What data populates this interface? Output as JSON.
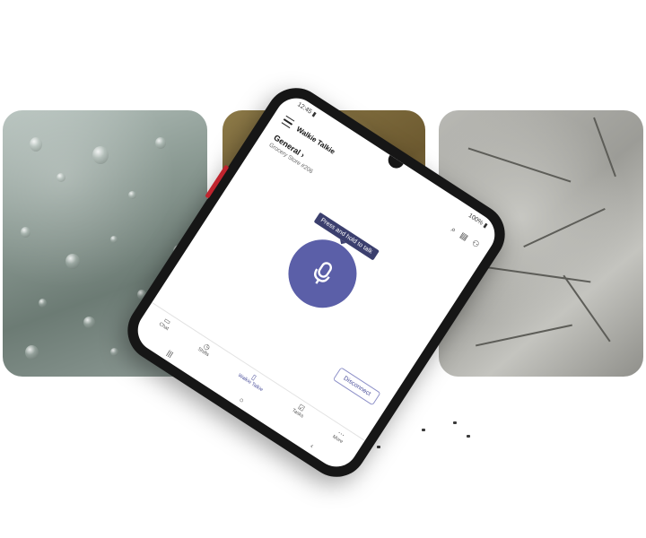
{
  "status_bar": {
    "time": "12:45",
    "signal": "▮",
    "battery": "100%"
  },
  "app": {
    "title": "Walkie Talkie"
  },
  "channel": {
    "name": "General",
    "chevron": "›",
    "team": "Grocery Store #206"
  },
  "push_to_talk": {
    "hint": "Press and hold to talk",
    "icon": "microphone-icon"
  },
  "actions": {
    "disconnect": "Disconnect"
  },
  "nav": {
    "items": [
      {
        "label": "Chat",
        "icon": "chat-icon"
      },
      {
        "label": "Shifts",
        "icon": "shifts-icon"
      },
      {
        "label": "Walkie Talkie",
        "icon": "walkie-talkie-icon",
        "active": true
      },
      {
        "label": "Tasks",
        "icon": "tasks-icon"
      },
      {
        "label": "More",
        "icon": "more-icon"
      }
    ]
  },
  "colors": {
    "accent": "#5b5fa8",
    "tooltip_bg": "#3b3f6e",
    "phone_body": "#161616",
    "side_button": "#c0242e"
  }
}
